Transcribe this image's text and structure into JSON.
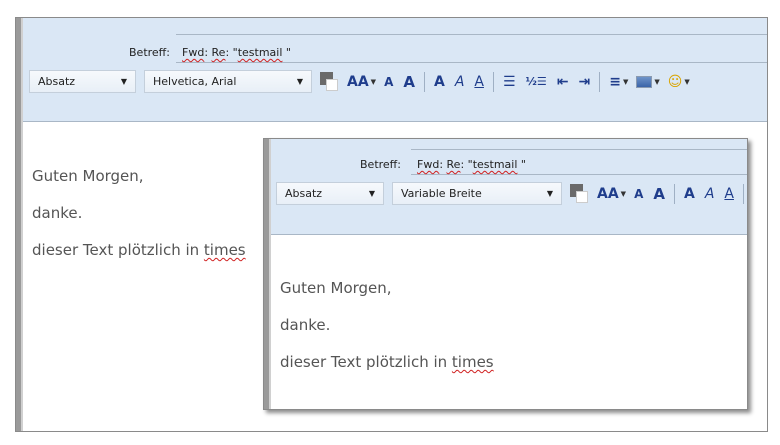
{
  "outer": {
    "subject_label": "Betreff:",
    "subject": {
      "part1": "Fwd",
      "part2": ":",
      "part3": "Re",
      ":": ":",
      "part4": ": \"",
      "part5": "testmail",
      "part6": " \""
    },
    "paragraph_select": "Absatz",
    "font_select": "Helvetica, Arial",
    "body_lines": [
      "Guten Morgen,",
      "danke.",
      "dieser Text plötzlich in ",
      "times"
    ]
  },
  "inner": {
    "subject_label": "Betreff:",
    "paragraph_select": "Absatz",
    "font_select": "Variable Breite",
    "body_lines": [
      "Guten Morgen,",
      "danke.",
      "dieser Text plötzlich in ",
      "times"
    ]
  },
  "icons": {
    "bold": "A",
    "italic": "A",
    "underline": "A",
    "size": "AA",
    "smaller": "A",
    "larger": "A"
  }
}
